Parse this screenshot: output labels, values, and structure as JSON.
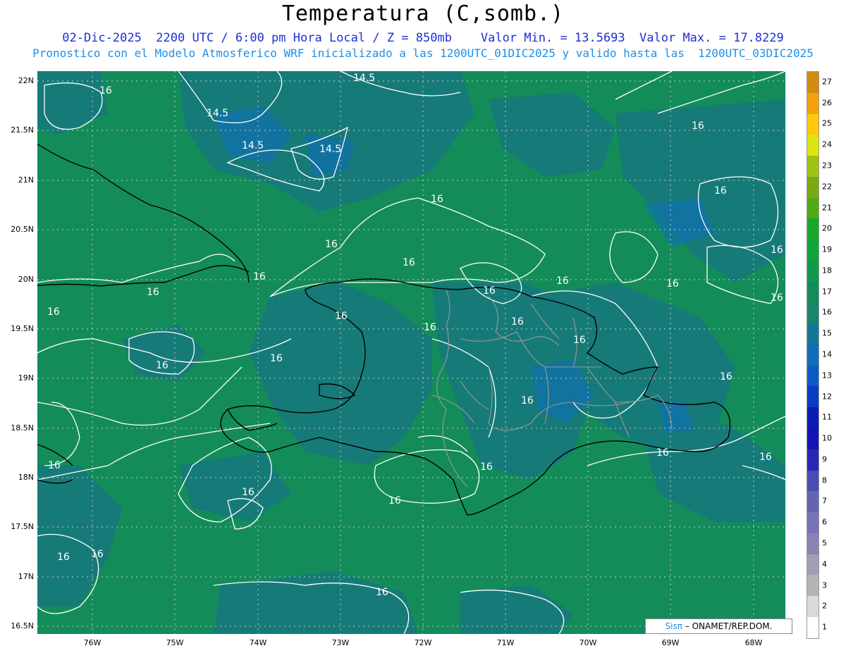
{
  "title": "Temperatura (C,somb.)",
  "subtitle_1": "02-Dic-2025  2200 UTC / 6:00 pm Hora Local / Z = 850mb    Valor Min. = 13.5693  Valor Max. = 17.8229",
  "subtitle_2": "Pronostico con el Modelo Atmosferico WRF inicializado a las 1200UTC_01DIC2025 y valido hasta las  1200UTC_03DIC2025",
  "lat_labels": [
    "22N",
    "21.5N",
    "21N",
    "20.5N",
    "20N",
    "19.5N",
    "19N",
    "18.5N",
    "18N",
    "17.5N",
    "17N",
    "16.5N"
  ],
  "lon_labels": [
    "76W",
    "75W",
    "74W",
    "73W",
    "72W",
    "71W",
    "70W",
    "69W",
    "68W"
  ],
  "colorbar": {
    "values": [
      "1",
      "2",
      "3",
      "4",
      "5",
      "6",
      "7",
      "8",
      "9",
      "10",
      "11",
      "12",
      "13",
      "14",
      "15",
      "16",
      "17",
      "18",
      "19",
      "20",
      "21",
      "22",
      "23",
      "24",
      "25",
      "26",
      "27"
    ],
    "colors": [
      "#ffffff",
      "#d9d9d9",
      "#b4b4b4",
      "#a0a0b4",
      "#8c82b4",
      "#7873b4",
      "#6464b4",
      "#4b4bb4",
      "#2828b4",
      "#1414b4",
      "#0a1eb4",
      "#0a3cc3",
      "#0a5ac8",
      "#0f6eb9",
      "#137896",
      "#17866e",
      "#138c5a",
      "#10994b",
      "#0fa53c",
      "#17aa28",
      "#50aa14",
      "#78aa14",
      "#a0c314",
      "#dce614",
      "#ffc80a",
      "#f5a00a",
      "#d28c14"
    ]
  },
  "contour_labels": [
    "16",
    "14.5",
    "14.5",
    "14.5",
    "14.5",
    "16",
    "16",
    "16",
    "16",
    "16",
    "16",
    "16",
    "16",
    "16",
    "16",
    "16",
    "16",
    "16",
    "16",
    "16",
    "16",
    "16",
    "16",
    "16",
    "16",
    "16",
    "16",
    "16",
    "16",
    "16",
    "16",
    "16",
    "16",
    "16",
    "16"
  ],
  "credit": {
    "logo": "Sisπ",
    "text": "– ONAMET/REP.DOM."
  }
}
